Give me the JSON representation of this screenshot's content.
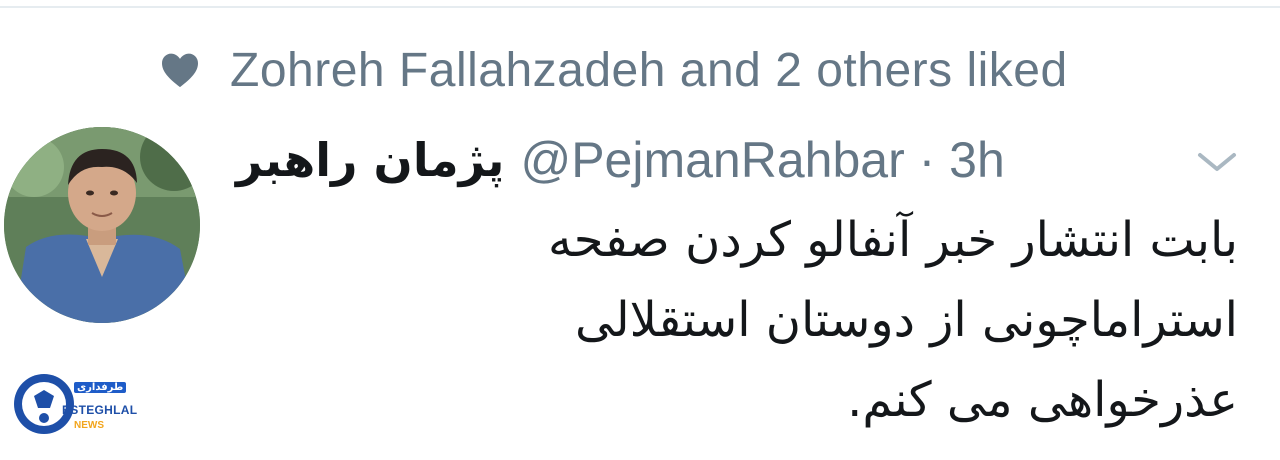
{
  "social_context": {
    "text": "Zohreh Fallahzadeh and 2 others liked",
    "icon": "heart-icon"
  },
  "tweet": {
    "display_name": "پژمان راهبر",
    "handle_time": "@PejmanRahbar · 3h",
    "body_lines": [
      "بابت انتشار خبر آنفالو کردن صفحه",
      "استراماچونی از دوستان استقلالی",
      "عذرخواهی می کنم."
    ],
    "menu_icon": "chevron-down-icon"
  },
  "watermark": {
    "brand_script": "طرفداری",
    "name": "ESTEGHLAL",
    "news": "NEWS"
  },
  "colors": {
    "secondary_text": "#657786",
    "primary_text": "#14171a",
    "divider": "#e6ecf0",
    "watermark_blue": "#1e4fa8",
    "watermark_orange": "#f2a51d"
  }
}
